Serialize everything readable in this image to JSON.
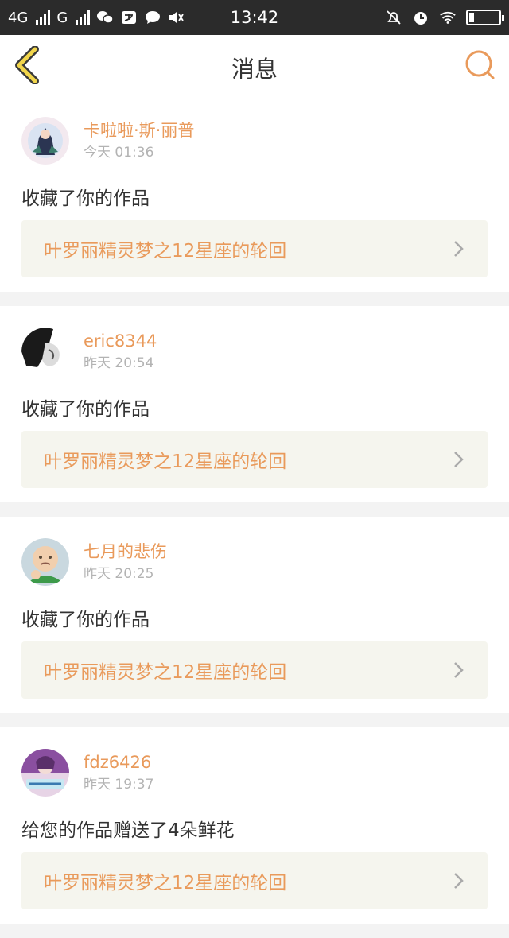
{
  "status_bar": {
    "network1": "4G",
    "network2": "G",
    "time": "13:42",
    "icons": [
      "wechat-icon",
      "alipay-icon",
      "chat-bubble-icon",
      "speaker-icon",
      "mute-bell-icon",
      "alarm-icon",
      "wifi-icon",
      "battery-icon"
    ]
  },
  "header": {
    "title": "消息",
    "back_icon": "chevron-left-icon",
    "search_icon": "search-icon",
    "accent": "#e99a5b"
  },
  "messages": [
    {
      "username": "卡啦啦·斯·丽普",
      "time": "今天 01:36",
      "action": "收藏了你的作品",
      "work_title": "叶罗丽精灵梦之12星座的轮回"
    },
    {
      "username": "eric8344",
      "time": "昨天 20:54",
      "action": "收藏了你的作品",
      "work_title": "叶罗丽精灵梦之12星座的轮回"
    },
    {
      "username": "七月的悲伤",
      "time": "昨天 20:25",
      "action": "收藏了你的作品",
      "work_title": "叶罗丽精灵梦之12星座的轮回"
    },
    {
      "username": "fdz6426",
      "time": "昨天 19:37",
      "action": "给您的作品赠送了4朵鲜花",
      "work_title": "叶罗丽精灵梦之12星座的轮回"
    }
  ]
}
